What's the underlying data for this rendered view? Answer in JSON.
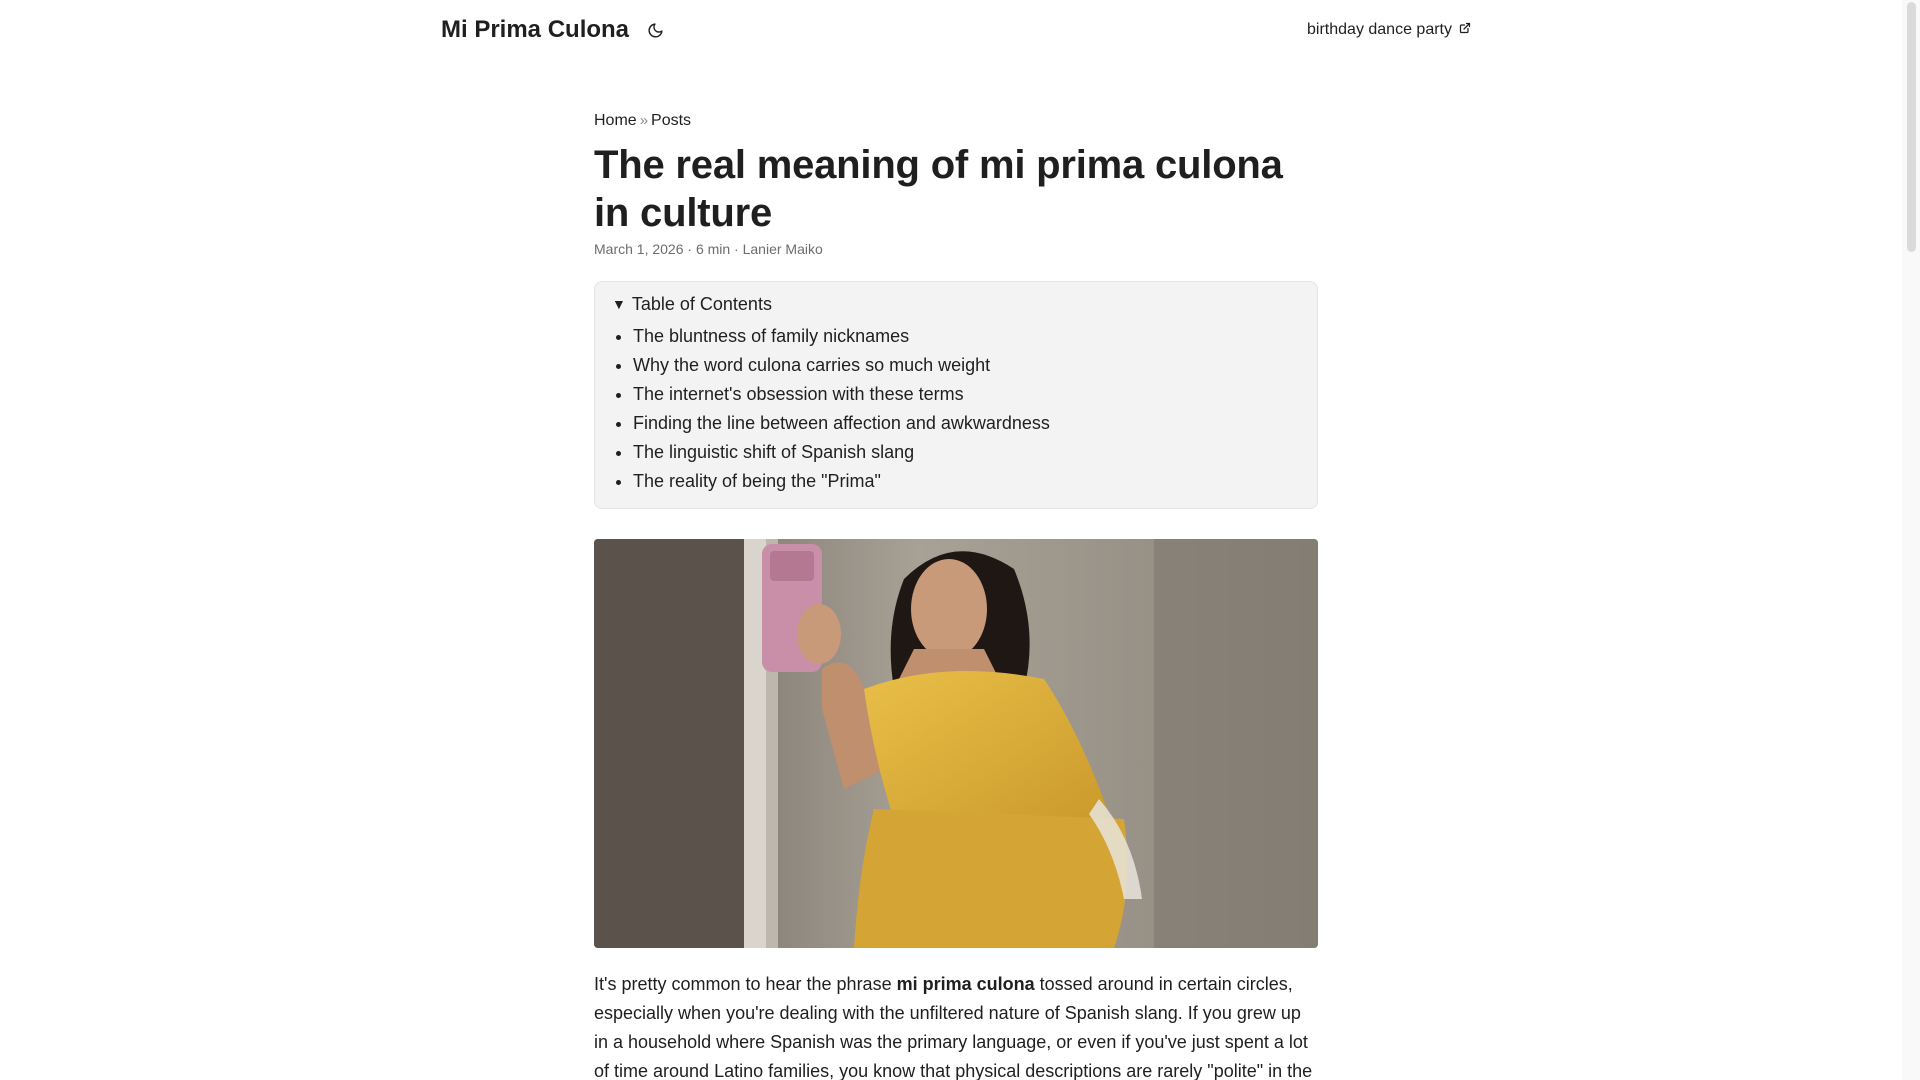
{
  "header": {
    "logo": "Mi Prima Culona",
    "theme_icon": "moon-icon",
    "menu_link": "birthday dance party",
    "menu_link_icon": "external-link-icon"
  },
  "breadcrumb": {
    "home": "Home",
    "separator": "»",
    "posts": "Posts"
  },
  "post": {
    "title": "The real meaning of mi prima culona in culture",
    "meta": "March 1, 2026 · 6 min · Lanier Maiko"
  },
  "toc": {
    "summary": "Table of Contents",
    "items": [
      "The bluntness of family nicknames",
      "Why the word culona carries so much weight",
      "The internet's obsession with these terms",
      "Finding the line between affection and awkwardness",
      "The linguistic shift of Spanish slang",
      "The reality of being the \"Prima\""
    ]
  },
  "content": {
    "intro_before": "It's pretty common to hear the phrase ",
    "intro_bold": "mi prima culona",
    "intro_after": " tossed around in certain circles, especially when you're dealing with the unfiltered nature of Spanish slang. If you grew up in a household where Spanish was the primary language, or even if you've just spent a lot of time around Latino families, you know that physical descriptions are rarely \"polite\" in the"
  },
  "colors": {
    "text": "#1f1f1f",
    "muted": "#6d6d6d",
    "toc_bg": "#f3f3f3",
    "dress": "#e0b43a"
  }
}
